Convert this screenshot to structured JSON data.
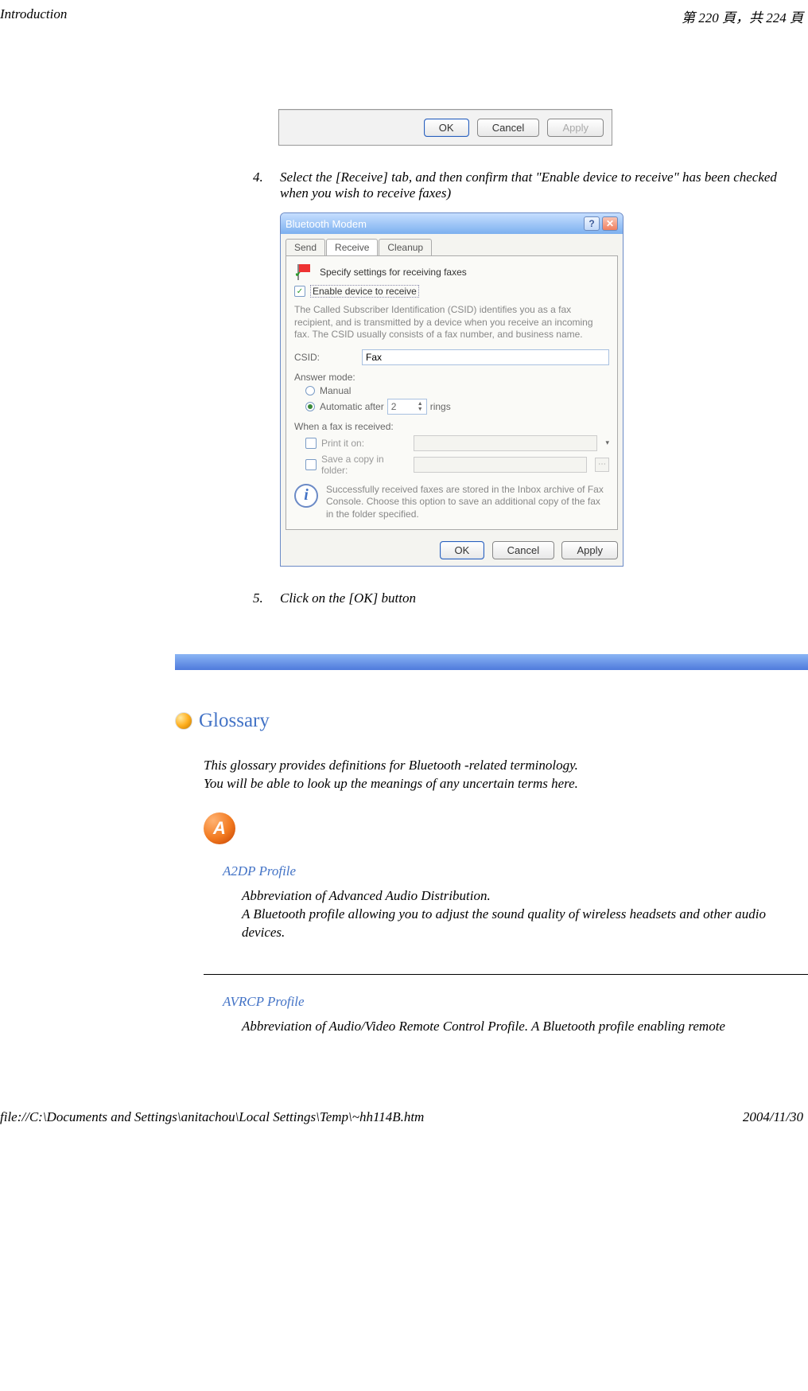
{
  "header": {
    "title": "Introduction",
    "page_info": "第 220 頁，共 224 頁"
  },
  "footer": {
    "path": "file://C:\\Documents and Settings\\anitachou\\Local Settings\\Temp\\~hh114B.htm",
    "date": "2004/11/30"
  },
  "dialog1": {
    "ok": "OK",
    "cancel": "Cancel",
    "apply": "Apply"
  },
  "step4": {
    "num": "4.",
    "text": "Select the [Receive] tab, and then confirm that \"Enable device to receive\" has been checked when you wish to receive faxes)"
  },
  "dialog2": {
    "title": "Bluetooth Modem",
    "help": "?",
    "close": "✕",
    "tabs": {
      "send": "Send",
      "receive": "Receive",
      "cleanup": "Cleanup"
    },
    "flagline": "Specify settings for receiving faxes",
    "enable_label": "Enable device to receive",
    "csid_para": "The Called Subscriber Identification (CSID) identifies you as a fax recipient, and is transmitted by a device when you receive an incoming fax. The CSID usually consists of a fax number, and business name.",
    "csid_lbl": "CSID:",
    "csid_val": "Fax",
    "answer_lbl": "Answer mode:",
    "manual": "Manual",
    "auto_after": "Automatic after",
    "auto_val": "2",
    "rings": "rings",
    "received_lbl": "When a fax is received:",
    "print": "Print it on:",
    "savecopy": "Save a copy in folder:",
    "info": "Successfully received faxes are stored in the Inbox archive of Fax Console. Choose this option to save an additional copy of the fax in the folder specified.",
    "ok": "OK",
    "cancel": "Cancel",
    "apply": "Apply"
  },
  "step5": {
    "num": "5.",
    "text": "Click on the [OK] button"
  },
  "glossary": {
    "heading": "Glossary",
    "intro1": "This glossary provides definitions for Bluetooth -related terminology.",
    "intro2": "You will be able to look up the meanings of any uncertain terms here.",
    "letter": "A",
    "a2dp": {
      "title": "A2DP Profile",
      "line1": "Abbreviation of Advanced Audio Distribution.",
      "line2": "A Bluetooth profile allowing you to adjust the sound quality of wireless headsets and other audio devices."
    },
    "avrcp": {
      "title": "AVRCP Profile",
      "line1": "Abbreviation of Audio/Video Remote Control Profile. A Bluetooth profile enabling remote"
    }
  }
}
